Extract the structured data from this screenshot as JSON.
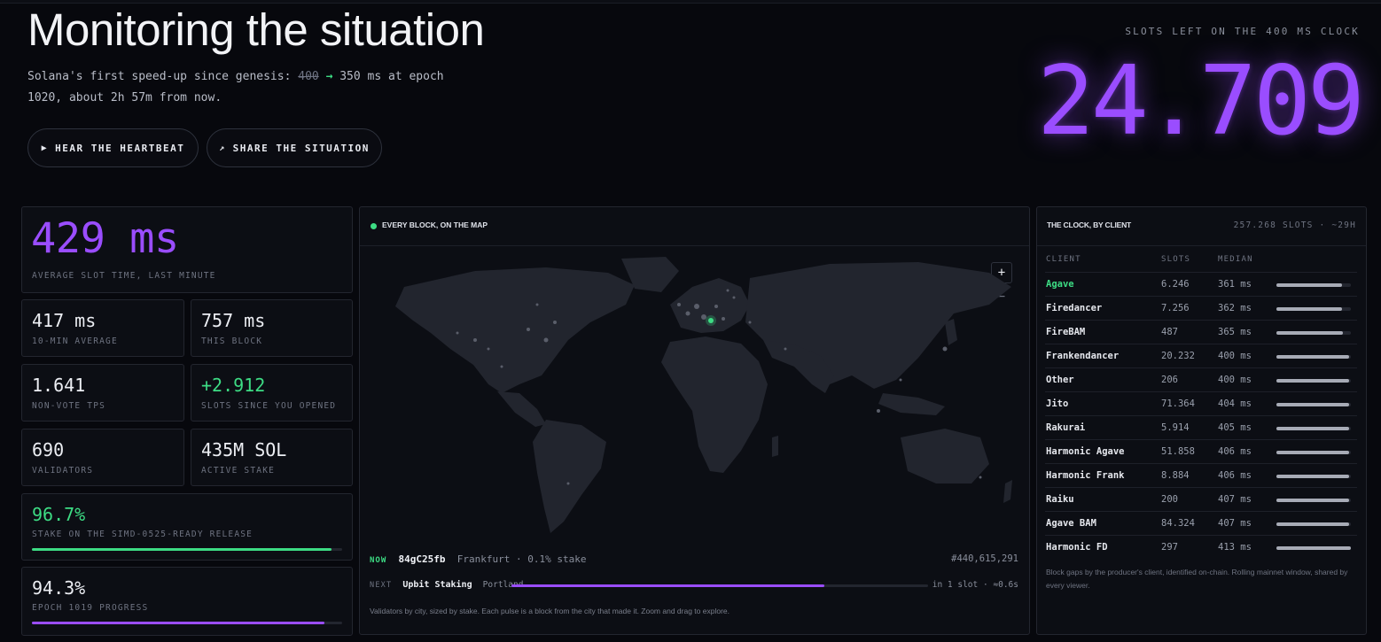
{
  "header": {
    "title": "Monitoring the situation",
    "subtitle_prefix": "Solana's first speed-up since genesis:",
    "old_ms": "400",
    "new_ms": "350 ms at epoch",
    "subtitle_line2": "1020, about 2h 57m from now.",
    "hear_button": "HEAR THE HEARTBEAT",
    "share_button": "SHARE THE SITUATION"
  },
  "countdown": {
    "label": "SLOTS LEFT ON THE 400 MS CLOCK",
    "value": "24.709"
  },
  "stats": {
    "avg_slot": {
      "value": "429 ms",
      "label": "AVERAGE SLOT TIME, LAST MINUTE"
    },
    "ten_min": {
      "value": "417 ms",
      "label": "10-MIN AVERAGE"
    },
    "this_block": {
      "value": "757 ms",
      "label": "THIS BLOCK"
    },
    "tps": {
      "value": "1.641",
      "label": "NON-VOTE TPS"
    },
    "slots_since": {
      "value": "+2.912",
      "label": "SLOTS SINCE YOU OPENED"
    },
    "validators": {
      "value": "690",
      "label": "VALIDATORS"
    },
    "stake": {
      "value": "435M SOL",
      "label": "ACTIVE STAKE"
    },
    "simd": {
      "value": "96.7%",
      "label": "STAKE ON THE SIMD-0525-READY RELEASE",
      "progress": 0.967
    },
    "epoch": {
      "value": "94.3%",
      "label": "EPOCH 1019 PROGRESS",
      "progress": 0.943
    }
  },
  "map": {
    "title": "EVERY BLOCK, ON THE MAP",
    "zoom_in": "+",
    "zoom_out": "−",
    "now_tag": "NOW",
    "now_id": "84gC25fb",
    "now_city": "Frankfurt · 0.1% stake",
    "now_slot": "#440,615,291",
    "next_tag": "NEXT",
    "next_name": "Upbit Staking",
    "next_city": "Portland",
    "next_progress": 0.75,
    "next_eta": "in 1 slot · ≈0.6s",
    "note": "Validators by city, sized by stake. Each pulse is a block from the city that made it. Zoom and drag to explore."
  },
  "clients": {
    "title": "THE CLOCK, BY CLIENT",
    "meta": "257.268 SLOTS · ~29H",
    "col_client": "CLIENT",
    "col_slots": "SLOTS",
    "col_median": "MEDIAN",
    "rows": [
      {
        "name": "Agave",
        "slots": "6.246",
        "median": "361 ms",
        "highlight": true,
        "bar": 0.88
      },
      {
        "name": "Firedancer",
        "slots": "7.256",
        "median": "362 ms",
        "highlight": false,
        "bar": 0.88
      },
      {
        "name": "FireBAM",
        "slots": "487",
        "median": "365 ms",
        "highlight": false,
        "bar": 0.89
      },
      {
        "name": "Frankendancer",
        "slots": "20.232",
        "median": "400 ms",
        "highlight": false,
        "bar": 0.98
      },
      {
        "name": "Other",
        "slots": "206",
        "median": "400 ms",
        "highlight": false,
        "bar": 0.98
      },
      {
        "name": "Jito",
        "slots": "71.364",
        "median": "404 ms",
        "highlight": false,
        "bar": 0.98
      },
      {
        "name": "Rakurai",
        "slots": "5.914",
        "median": "405 ms",
        "highlight": false,
        "bar": 0.98
      },
      {
        "name": "Harmonic Agave",
        "slots": "51.858",
        "median": "406 ms",
        "highlight": false,
        "bar": 0.98
      },
      {
        "name": "Harmonic Frank",
        "slots": "8.884",
        "median": "406 ms",
        "highlight": false,
        "bar": 0.98
      },
      {
        "name": "Raiku",
        "slots": "200",
        "median": "407 ms",
        "highlight": false,
        "bar": 0.98
      },
      {
        "name": "Agave BAM",
        "slots": "84.324",
        "median": "407 ms",
        "highlight": false,
        "bar": 0.98
      },
      {
        "name": "Harmonic FD",
        "slots": "297",
        "median": "413 ms",
        "highlight": false,
        "bar": 1.0
      }
    ],
    "note": "Block gaps by the producer's client, identified on-chain. Rolling mainnet window, shared by every viewer."
  },
  "colors": {
    "accent_purple": "#9a4dff",
    "accent_green": "#3ddc84",
    "bar_gray": "#a7abb6"
  }
}
